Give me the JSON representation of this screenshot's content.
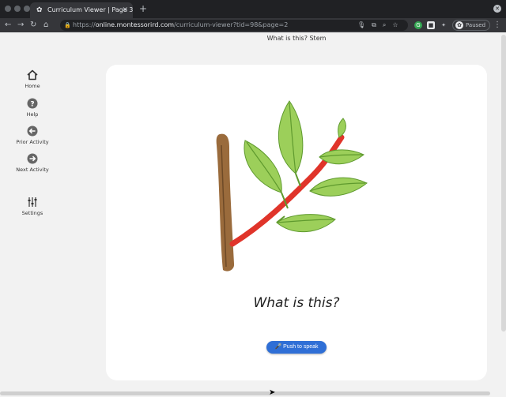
{
  "browser": {
    "tab_title": "Curriculum Viewer | Page 3 | …",
    "new_tab_icon": "+",
    "url_scheme": "https://",
    "url_host": "online.montessorird.com",
    "url_path": "/curriculum-viewer?tid=98&page=2",
    "profile_label": "Paused"
  },
  "page": {
    "header": "What is this? Stem"
  },
  "sidebar": {
    "items": [
      {
        "label": "Home",
        "icon": "home-icon"
      },
      {
        "label": "Help",
        "icon": "help-icon"
      },
      {
        "label": "Prior Activity",
        "icon": "arrow-left-icon"
      },
      {
        "label": "Next Activity",
        "icon": "arrow-right-icon"
      },
      {
        "label": "Settings",
        "icon": "sliders-icon"
      }
    ]
  },
  "card": {
    "question": "What is this?",
    "speak_button": "Push to speak"
  },
  "colors": {
    "button": "#2f6fd6",
    "stem_red": "#e0342a",
    "leaf_green": "#9ccf5a",
    "stick_brown": "#9a6b3c"
  }
}
